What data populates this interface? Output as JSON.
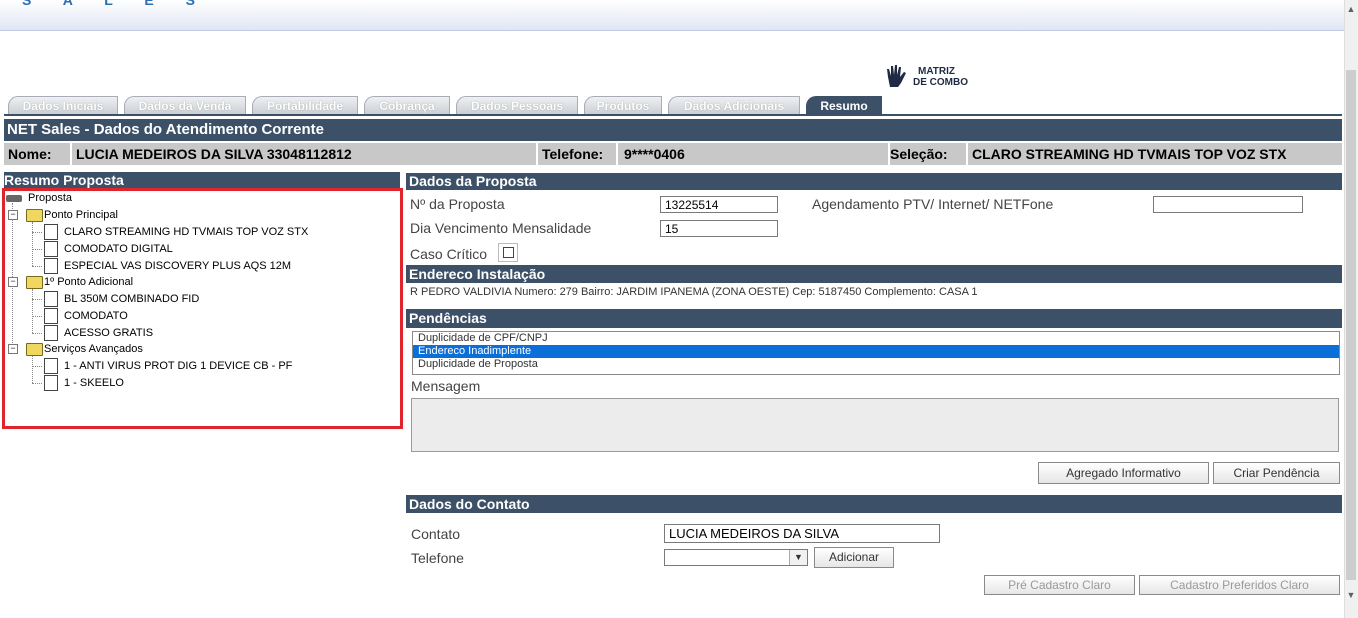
{
  "app": {
    "brand": "S A L E S"
  },
  "logo": {
    "text_line1": "MATRIZ",
    "text_line2": "DE COMBO",
    "icon": "hand-icon"
  },
  "tabs": [
    {
      "label": "Dados Iniciais",
      "active": false
    },
    {
      "label": "Dados da Venda",
      "active": false
    },
    {
      "label": "Portabilidade",
      "active": false
    },
    {
      "label": "Cobrança",
      "active": false
    },
    {
      "label": "Dados Pessoais",
      "active": false
    },
    {
      "label": "Produtos",
      "active": false
    },
    {
      "label": "Dados Adicionais",
      "active": false
    },
    {
      "label": "Resumo",
      "active": true
    }
  ],
  "header": {
    "title": "NET Sales - Dados do Atendimento Corrente",
    "nome_label": "Nome:",
    "nome_value": "LUCIA MEDEIROS DA SILVA 33048112812",
    "telefone_label": "Telefone:",
    "telefone_value": "9****0406",
    "selecao_label": "Seleção:",
    "selecao_value": "CLARO STREAMING HD TVMAIS TOP VOZ STX"
  },
  "resumo": {
    "title": "Resumo Proposta",
    "root": "Proposta",
    "groups": [
      {
        "label": "Ponto Principal",
        "items": [
          "CLARO STREAMING HD TVMAIS TOP VOZ STX",
          "COMODATO DIGITAL",
          "ESPECIAL VAS DISCOVERY PLUS AQS 12M"
        ]
      },
      {
        "label": "1º Ponto Adicional",
        "items": [
          "BL 350M COMBINADO FID",
          "COMODATO",
          "ACESSO GRATIS"
        ]
      },
      {
        "label": "Serviços Avançados",
        "items": [
          "1 - ANTI VIRUS PROT DIG 1 DEVICE CB - PF",
          "1 - SKEELO"
        ]
      }
    ]
  },
  "proposta": {
    "title": "Dados da Proposta",
    "num_label": "Nº da Proposta",
    "num_value": "13225514",
    "agendamento_label": "Agendamento PTV/ Internet/ NETFone",
    "agendamento_value": "",
    "dia_label": "Dia Vencimento Mensalidade",
    "dia_value": "15",
    "critico_label": "Caso Crítico"
  },
  "endereco": {
    "title": "Endereco Instalação",
    "text": "R PEDRO VALDIVIA Numero: 279 Bairro: JARDIM IPANEMA (ZONA OESTE) Cep: 5187450 Complemento: CASA 1"
  },
  "pendencias": {
    "title": "Pendências",
    "items": [
      {
        "label": "Duplicidade de CPF/CNPJ",
        "selected": false
      },
      {
        "label": "Endereco Inadimplente",
        "selected": true
      },
      {
        "label": "Duplicidade de Proposta",
        "selected": false
      }
    ],
    "mensagem_label": "Mensagem",
    "mensagem_value": "",
    "btn_agregado": "Agregado Informativo",
    "btn_criar": "Criar Pendência"
  },
  "contato": {
    "title": "Dados do Contato",
    "contato_label": "Contato",
    "contato_value": "LUCIA MEDEIROS DA SILVA",
    "telefone_label": "Telefone",
    "telefone_value": "",
    "btn_adicionar": "Adicionar",
    "btn_pre_cadastro": "Pré Cadastro Claro",
    "btn_preferidos": "Cadastro Preferidos Claro"
  },
  "colors": {
    "header_bg": "#3c5068",
    "info_bg": "#c8c8c8",
    "highlight_border": "#e0242c",
    "selection": "#0a6fd8"
  }
}
